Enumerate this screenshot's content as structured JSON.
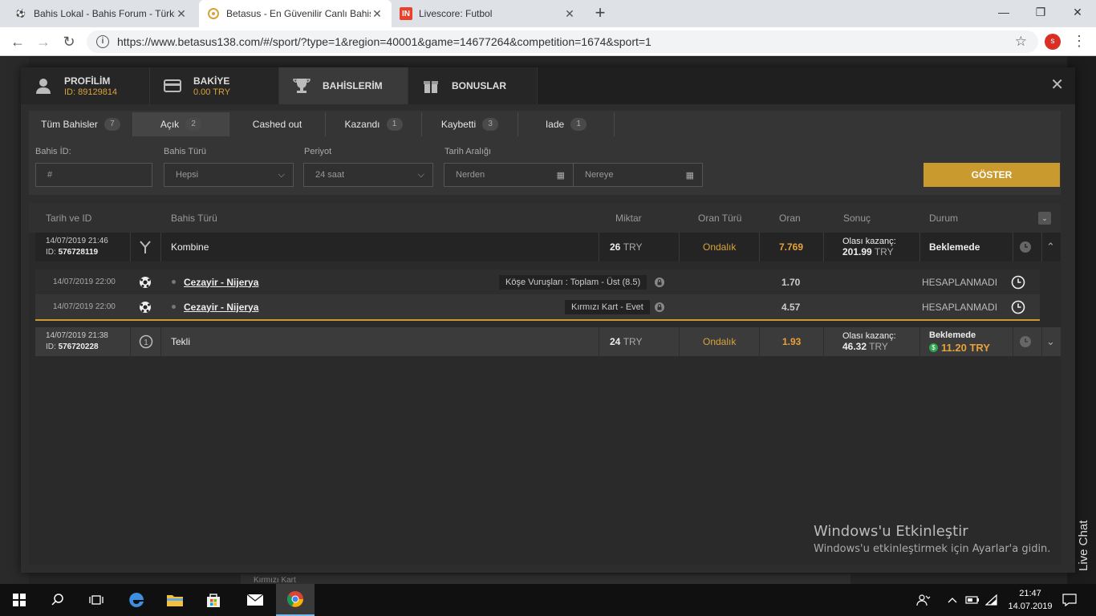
{
  "browser": {
    "tabs": [
      {
        "title": "Bahis Lokal - Bahis Forum - Türki"
      },
      {
        "title": "Betasus - En Güvenilir Canlı Bahis"
      },
      {
        "title": "Livescore: Futbol"
      }
    ],
    "url": "https://www.betasus138.com/#/sport/?type=1&region=40001&game=14677264&competition=1674&sport=1",
    "profile_initial": "s"
  },
  "modal": {
    "tabs": [
      {
        "label": "PROFİLİM",
        "sub": "ID: 89129814"
      },
      {
        "label": "BAKİYE",
        "sub": "0.00 TRY"
      },
      {
        "label": "BAHİSLERİM",
        "sub": ""
      },
      {
        "label": "BONUSLAR",
        "sub": ""
      }
    ],
    "filter_tabs": [
      {
        "label": "Tüm Bahisler",
        "count": "7"
      },
      {
        "label": "Açık",
        "count": "2"
      },
      {
        "label": "Cashed out",
        "count": ""
      },
      {
        "label": "Kazandı",
        "count": "1"
      },
      {
        "label": "Kaybetti",
        "count": "3"
      },
      {
        "label": "Iade",
        "count": "1"
      }
    ],
    "filters": {
      "bet_id_label": "Bahis İD:",
      "bet_id_placeholder": "#",
      "bet_type_label": "Bahis Türü",
      "bet_type_value": "Hepsi",
      "period_label": "Periyot",
      "period_value": "24 saat",
      "date_range_label": "Tarih Aralığı",
      "from_placeholder": "Nerden",
      "to_placeholder": "Nereye",
      "submit": "GÖSTER"
    },
    "table": {
      "headers": [
        "Tarih ve ID",
        "Bahis Türü",
        "Miktar",
        "Oran Türü",
        "Oran",
        "Sonuç",
        "Durum"
      ],
      "bets": [
        {
          "date": "14/07/2019 21:46",
          "id_label": "ID:",
          "id": "576728119",
          "type": "Kombine",
          "amount": "26",
          "currency": "TRY",
          "odds_type": "Ondalık",
          "odds": "7.769",
          "result_label": "Olası kazanç:",
          "result_value": "201.99",
          "result_currency": "TRY",
          "status": "Beklemede",
          "cashout": "",
          "selections": [
            {
              "date": "14/07/2019 22:00",
              "match": "Cezayir - Nijerya",
              "market": "Köşe Vuruşları : Toplam - Üst (8.5)",
              "odds": "1.70",
              "status": "HESAPLANMADI"
            },
            {
              "date": "14/07/2019 22:00",
              "match": "Cezayir - Nijerya",
              "market": "Kırmızı Kart - Evet",
              "odds": "4.57",
              "status": "HESAPLANMADI"
            }
          ]
        },
        {
          "date": "14/07/2019 21:38",
          "id_label": "ID:",
          "id": "576720228",
          "type": "Tekli",
          "amount": "24",
          "currency": "TRY",
          "odds_type": "Ondalık",
          "odds": "1.93",
          "result_label": "Olası kazanç:",
          "result_value": "46.32",
          "result_currency": "TRY",
          "status": "Beklemede",
          "cashout": "11.20 TRY"
        }
      ]
    }
  },
  "page_bottom_text": "Kırmızı Kart",
  "watermark": {
    "title": "Windows'u Etkinleştir",
    "subtitle": "Windows'u etkinleştirmek için Ayarlar'a gidin."
  },
  "livechat_label": "Live Chat",
  "taskbar": {
    "time": "21:47",
    "date": "14.07.2019"
  },
  "colors": {
    "accent": "#c99a2e",
    "odds": "#e8a23a",
    "cashout": "#2ea44f"
  }
}
